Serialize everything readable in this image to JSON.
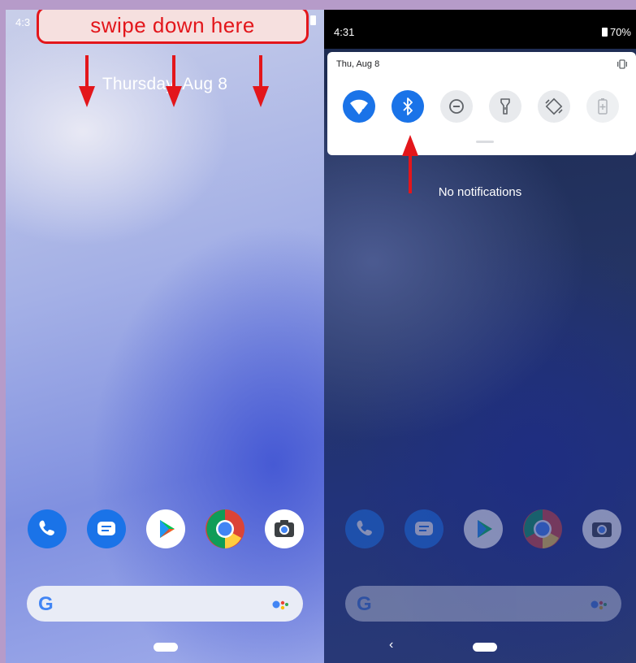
{
  "left_screen": {
    "status_time": "4:3",
    "date": "Thursday, Aug 8",
    "dock_apps": [
      "phone-icon",
      "messages-icon",
      "play-store-icon",
      "chrome-icon",
      "camera-icon"
    ],
    "search_logo": "G"
  },
  "annotation": {
    "label": "swipe down here",
    "color": "#e3161b"
  },
  "right_screen": {
    "status_time": "4:31",
    "battery": "70%",
    "panel_date": "Thu, Aug 8",
    "tiles": [
      {
        "icon": "wifi-icon",
        "active": true
      },
      {
        "icon": "bluetooth-icon",
        "active": true
      },
      {
        "icon": "do-not-disturb-icon",
        "active": false
      },
      {
        "icon": "flashlight-icon",
        "active": false
      },
      {
        "icon": "auto-rotate-icon",
        "active": false
      },
      {
        "icon": "battery-saver-icon",
        "active": false
      }
    ],
    "empty_message": "No notifications",
    "nav_back": "‹",
    "search_logo": "G"
  },
  "colors": {
    "tile_active": "#1a73e8",
    "tile_inactive": "#e8eaed",
    "frame": "#b69bc9"
  }
}
